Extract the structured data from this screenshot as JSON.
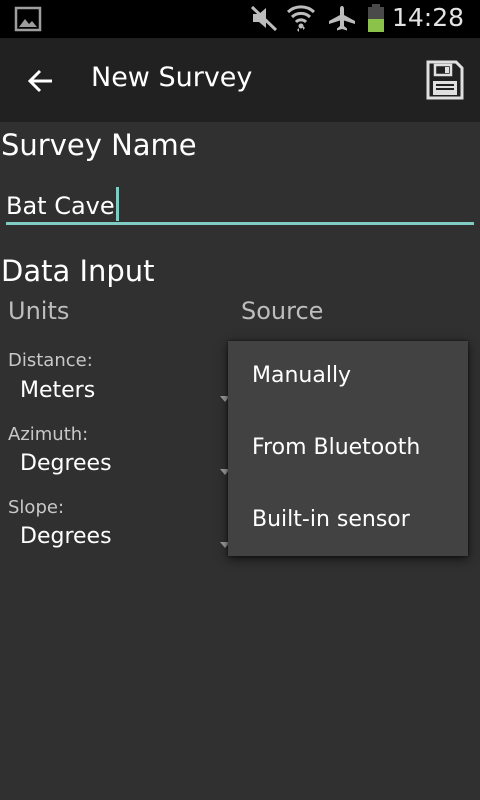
{
  "status_bar": {
    "time": "14:28",
    "icons": [
      "gallery-icon",
      "mute-icon",
      "wifi-icon",
      "airplane-icon",
      "battery-icon"
    ],
    "battery_level": 0.25,
    "battery_color": "#8bc34a"
  },
  "action_bar": {
    "title": "New Survey",
    "back_icon": "arrow-back-icon",
    "save_icon": "floppy-disk-icon"
  },
  "survey_name": {
    "heading": "Survey Name",
    "value": "Bat Cave",
    "accent_color": "#80cbc4"
  },
  "data_input": {
    "heading": "Data Input",
    "units_header": "Units",
    "source_header": "Source",
    "fields": [
      {
        "label": "Distance:",
        "value": "Meters"
      },
      {
        "label": "Azimuth:",
        "value": "Degrees"
      },
      {
        "label": "Slope:",
        "value": "Degrees"
      }
    ]
  },
  "source_menu": {
    "items": [
      "Manually",
      "From Bluetooth",
      "Built-in sensor"
    ]
  },
  "colors": {
    "background": "#303030",
    "action_bar": "#212121",
    "menu": "#424242"
  }
}
